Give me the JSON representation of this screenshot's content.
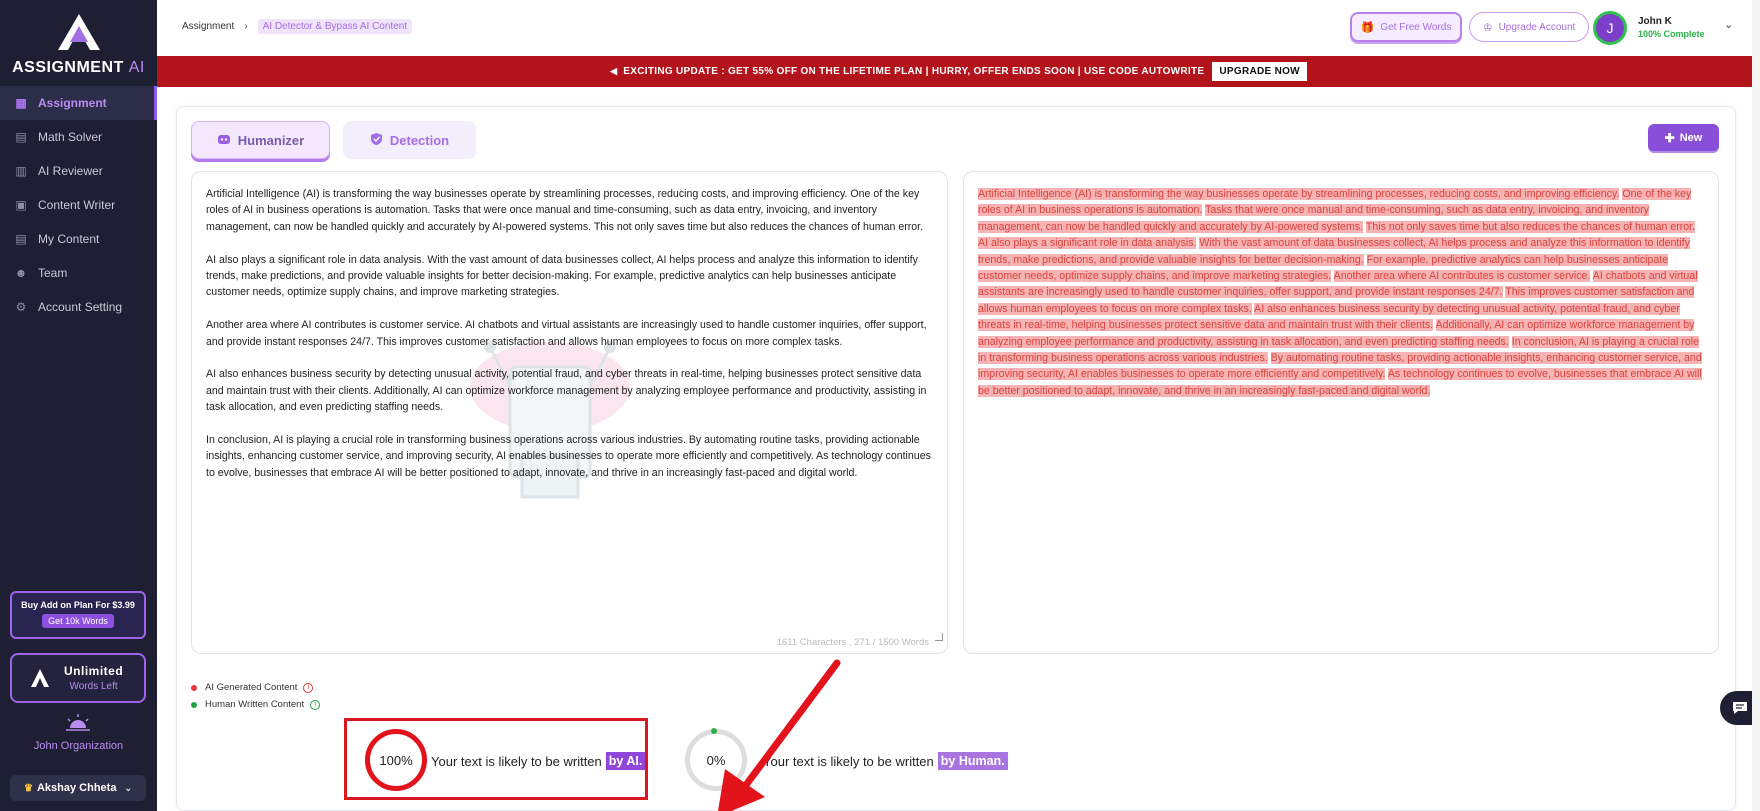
{
  "brand": {
    "name": "ASSIGNMENT",
    "suffix": "AI"
  },
  "sidebar": {
    "items": [
      {
        "label": "Assignment",
        "icon": "grid-icon",
        "active": true
      },
      {
        "label": "Math Solver",
        "icon": "calculator-icon"
      },
      {
        "label": "AI Reviewer",
        "icon": "review-icon"
      },
      {
        "label": "Content Writer",
        "icon": "document-icon"
      },
      {
        "label": "My Content",
        "icon": "folder-icon"
      },
      {
        "label": "Team",
        "icon": "team-icon"
      },
      {
        "label": "Account Setting",
        "icon": "gear-icon"
      }
    ],
    "addon": {
      "title": "Buy Add on Plan For $3.99",
      "button": "Get 10k Words"
    },
    "plan": {
      "title": "Unlimited",
      "subtitle": "Words Left"
    },
    "organization": "John Organization",
    "user_selector": "Akshay Chheta"
  },
  "header": {
    "breadcrumb": [
      "Assignment",
      "AI Detector & Bypass AI Content"
    ],
    "free_words_label": "Get Free Words",
    "upgrade_label": "Upgrade Account",
    "profile": {
      "initial": "J",
      "name": "John K",
      "status": "100% Complete"
    }
  },
  "promo": {
    "text": "EXCITING UPDATE : GET 55% OFF ON THE LIFETIME PLAN | HURRY, OFFER ENDS SOON | USE CODE AUTOWRITE",
    "button": "UPGRADE NOW"
  },
  "tabs": {
    "humanizer": "Humanizer",
    "detection": "Detection"
  },
  "new_button": "New",
  "input": {
    "paragraphs": [
      "Artificial Intelligence (AI) is transforming the way businesses operate by streamlining processes, reducing costs, and improving efficiency. One of the key roles of AI in business operations is automation. Tasks that were once manual and time-consuming, such as data entry, invoicing, and inventory management, can now be handled quickly and accurately by AI-powered systems. This not only saves time but also reduces the chances of human error.",
      "AI also plays a significant role in data analysis. With the vast amount of data businesses collect, AI helps process and analyze this information to identify trends, make predictions, and provide valuable insights for better decision-making. For example, predictive analytics can help businesses anticipate customer needs, optimize supply chains, and improve marketing strategies.",
      "Another area where AI contributes is customer service. AI chatbots and virtual assistants are increasingly used to handle customer inquiries, offer support, and provide instant responses 24/7. This improves customer satisfaction and allows human employees to focus on more complex tasks.",
      "AI also enhances business security by detecting unusual activity, potential fraud, and cyber threats in real-time, helping businesses protect sensitive data and maintain trust with their clients. Additionally, AI can optimize workforce management by analyzing employee performance and productivity, assisting in task allocation, and even predicting staffing needs.",
      "In conclusion, AI is playing a crucial role in transforming business operations across various industries. By automating routine tasks, providing actionable insights, enhancing customer service, and improving security, AI enables businesses to operate more efficiently and competitively. As technology continues to evolve, businesses that embrace AI will be better positioned to adapt, innovate, and thrive in an increasingly fast-paced and digital world."
    ],
    "char_count": "1611 Characters , 271 / 1500 Words"
  },
  "output": {
    "sentences": [
      "Artificial Intelligence (AI) is transforming the way businesses operate by streamlining processes, reducing costs, and improving efficiency.",
      "One of the key roles of AI in business operations is automation.",
      "Tasks that were once manual and time-consuming, such as data entry, invoicing, and inventory management, can now be handled quickly and accurately by AI-powered systems.",
      "This not only saves time but also reduces the chances of human error.",
      "AI also plays a significant role in data analysis.",
      "With the vast amount of data businesses collect, AI helps process and analyze this information to identify trends, make predictions, and provide valuable insights for better decision-making.",
      "For example, predictive analytics can help businesses anticipate customer needs, optimize supply chains, and improve marketing strategies.",
      "Another area where AI contributes is customer service.",
      "AI chatbots and virtual assistants are increasingly used to handle customer inquiries, offer support, and provide instant responses 24/7.",
      "This improves customer satisfaction and allows human employees to focus on more complex tasks.",
      "AI also enhances business security by detecting unusual activity, potential fraud, and cyber threats in real-time, helping businesses protect sensitive data and maintain trust with their clients.",
      "Additionally, AI can optimize workforce management by analyzing employee performance and productivity, assisting in task allocation, and even predicting staffing needs.",
      "In conclusion, AI is playing a crucial role in transforming business operations across various industries.",
      "By automating routine tasks, providing actionable insights, enhancing customer service, and improving security, AI enables businesses to operate more efficiently and competitively.",
      "As technology continues to evolve, businesses that embrace AI will be better positioned to adapt, innovate, and thrive in an increasingly fast-paced and digital world."
    ]
  },
  "legend": {
    "ai": "AI Generated Content",
    "human": "Human Written Content"
  },
  "results": {
    "ai": {
      "percent": "100%",
      "text": "Your text is likely to be written",
      "tag": "by AI."
    },
    "human": {
      "percent": "0%",
      "text": "Your text is likely to be written",
      "tag": "by Human."
    }
  },
  "colors": {
    "accent": "#8a4fd8",
    "ai_red": "#e3131b",
    "human_green": "#2ab047",
    "sidebar_bg": "#1e1f33",
    "promo_bg": "#b3141c"
  }
}
